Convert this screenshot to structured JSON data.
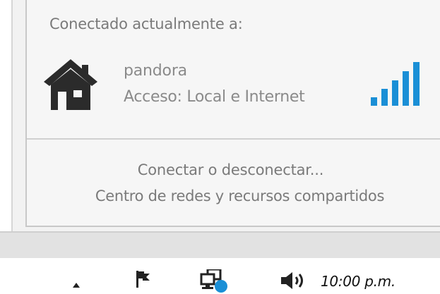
{
  "flyout": {
    "connected_label": "Conectado actualmente a:",
    "network": {
      "name": "pandora",
      "access": "Acceso: Local e Internet",
      "icon": "house-icon",
      "signal_icon": "signal-strength-icon",
      "signal_bars": 5
    },
    "links": {
      "connect_disconnect": "Conectar o desconectar...",
      "network_center": "Centro de redes y recursos compartidos"
    }
  },
  "taskbar": {
    "clock": "10:00 p.m.",
    "icons": [
      "show-hidden-icons-arrow",
      "action-center-flag-icon",
      "network-icon",
      "volume-icon"
    ]
  },
  "colors": {
    "signal": "#1a8fd6",
    "text_muted": "#8a8a8a",
    "icon_dark": "#2b2b2b"
  }
}
